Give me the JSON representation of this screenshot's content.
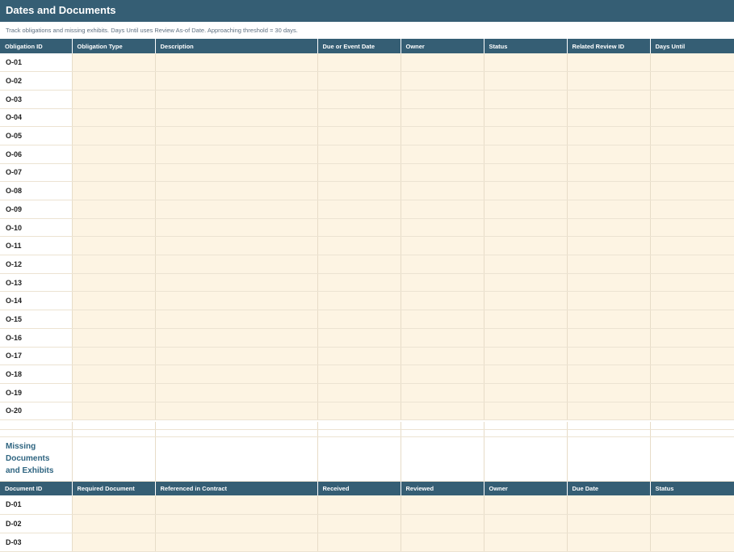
{
  "title": "Dates and Documents",
  "subtitle": "Track obligations and missing exhibits. Days Until uses Review As-of Date. Approaching threshold = 30 days.",
  "obligations": {
    "headers": [
      "Obligation ID",
      "Obligation Type",
      "Description",
      "Due or Event Date",
      "Owner",
      "Status",
      "Related Review ID",
      "Days Until"
    ],
    "rows": [
      "O-01",
      "O-02",
      "O-03",
      "O-04",
      "O-05",
      "O-06",
      "O-07",
      "O-08",
      "O-09",
      "O-10",
      "O-11",
      "O-12",
      "O-13",
      "O-14",
      "O-15",
      "O-16",
      "O-17",
      "O-18",
      "O-19",
      "O-20"
    ]
  },
  "documents": {
    "section_label": "Missing Documents and Exhibits",
    "headers": [
      "Document ID",
      "Required Document",
      "Referenced in Contract",
      "Received",
      "Reviewed",
      "Owner",
      "Due Date",
      "Status"
    ],
    "rows": [
      "D-01",
      "D-02",
      "D-03"
    ]
  },
  "colors": {
    "header_bg": "#355e74",
    "input_cell_bg": "#fdf4e3",
    "section_text": "#2e6480"
  }
}
